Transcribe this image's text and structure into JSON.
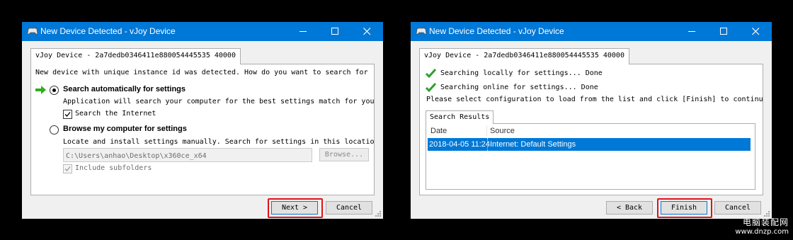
{
  "window_left": {
    "title": "New Device Detected - vJoy Device",
    "tab_label": "vJoy Device - 2a7dedb0346411e880054445535 40000",
    "prompt": "New device with unique instance id was detected. How do you want to search for",
    "option_auto": {
      "label": "Search automatically for settings",
      "description": "Application will search your computer for the best settings match for your dev",
      "checkbox_label": "Search the Internet",
      "selected": true,
      "checked": true
    },
    "option_browse": {
      "label": "Browse my computer for settings",
      "description": "Locate and install settings manually. Search for settings in this location:",
      "path_value": "C:\\Users\\anhao\\Desktop\\x360ce_x64",
      "browse_button": "Browse...",
      "checkbox_label": "Include subfolders",
      "selected": false,
      "checked": true
    },
    "buttons": {
      "next": "Next >",
      "cancel": "Cancel"
    }
  },
  "window_right": {
    "title": "New Device Detected - vJoy Device",
    "tab_label": "vJoy Device - 2a7dedb0346411e880054445535 40000",
    "status": [
      {
        "text": "Searching locally for settings... Done",
        "icon": "check-icon"
      },
      {
        "text": "Searching online for settings... Done",
        "icon": "check-icon"
      }
    ],
    "instruction": "Please select configuration to load from the list and click [Finish] to continue.",
    "results_tab": "Search Results",
    "columns": [
      "Date",
      "Source"
    ],
    "rows": [
      {
        "date": "2018-04-05 11:24",
        "source": "Internet: Default Settings",
        "selected": true
      }
    ],
    "buttons": {
      "back": "< Back",
      "finish": "Finish",
      "cancel": "Cancel"
    }
  },
  "watermark": {
    "line1": "电脑装配网",
    "line2": "www.dnzp.com"
  },
  "colors": {
    "titlebar": "#0078d7",
    "highlight_box": "#e0131b",
    "check_green": "#2f9e2f",
    "arrow_green": "#2fae1d"
  }
}
